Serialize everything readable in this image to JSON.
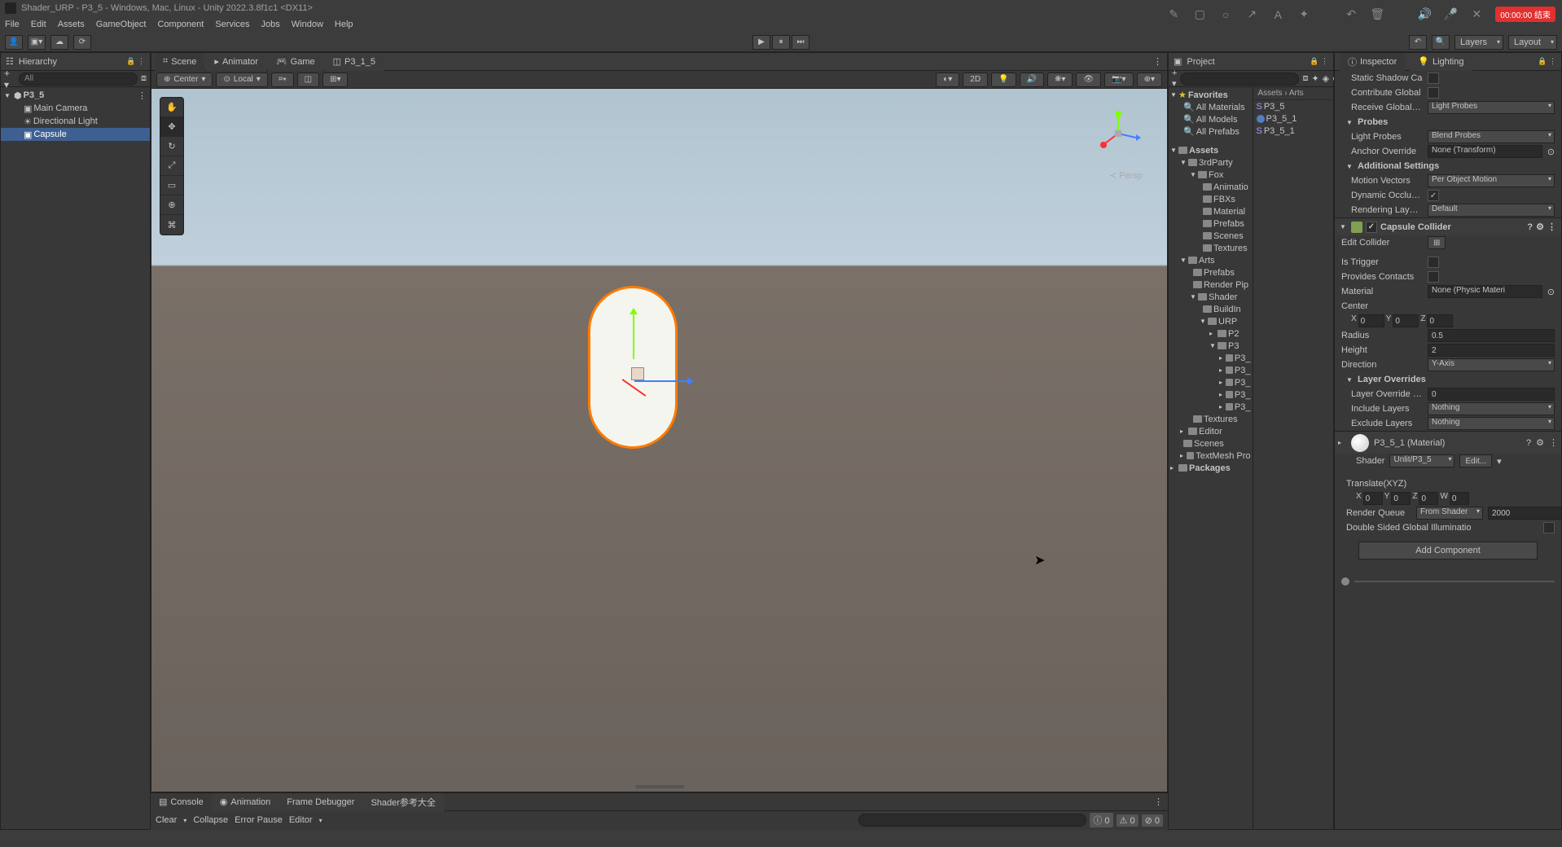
{
  "title": "Shader_URP - P3_5 - Windows, Mac, Linux - Unity 2022.3.8f1c1 <DX11>",
  "menu": {
    "file": "File",
    "edit": "Edit",
    "assets": "Assets",
    "gameObject": "GameObject",
    "component": "Component",
    "services": "Services",
    "jobs": "Jobs",
    "window": "Window",
    "help": "Help"
  },
  "topright": {
    "rec": "00:00:00 结束"
  },
  "toolbar": {
    "layers": "Layers",
    "layout": "Layout"
  },
  "hierarchy": {
    "title": "Hierarchy",
    "search": "All",
    "root": "P3_5",
    "items": [
      "Main Camera",
      "Directional Light",
      "Capsule"
    ]
  },
  "sceneTabs": {
    "scene": "Scene",
    "animator": "Animator",
    "game": "Game",
    "p315": "P3_1_5"
  },
  "sceneBar": {
    "center": "Center",
    "local": "Local",
    "twod": "2D",
    "persp": "Persp"
  },
  "project": {
    "title": "Project",
    "breadcrumb_assets": "Assets",
    "breadcrumb_arts": "Arts",
    "favorites": "Favorites",
    "favItems": [
      "All Materials",
      "All Models",
      "All Prefabs"
    ],
    "assets": "Assets",
    "folders": {
      "thirdparty": "3rdParty",
      "fox": "Fox",
      "animatio": "Animatio",
      "fbxs": "FBXs",
      "material": "Material",
      "prefabs": "Prefabs",
      "scenes": "Scenes",
      "textures": "Textures",
      "arts": "Arts",
      "renderpip": "Render Pip",
      "shader": "Shader",
      "buildin": "BuildIn",
      "urp": "URP",
      "p2": "P2",
      "p3": "P3",
      "p3_": "P3_",
      "editor": "Editor",
      "tmpro": "TextMesh Pro",
      "packages": "Packages"
    },
    "rightItems": [
      "P3_5",
      "P3_5_1",
      "P3_5_1"
    ]
  },
  "inspector": {
    "tab1": "Inspector",
    "tab2": "Lighting",
    "staticShadow": "Static Shadow Ca",
    "contribGlobal": "Contribute Global",
    "recvGlobal": "Receive Global Illu",
    "recvGlobalVal": "Light Probes",
    "probesHdr": "Probes",
    "lightProbes": "Light Probes",
    "lightProbesVal": "Blend Probes",
    "anchorOverride": "Anchor Override",
    "anchorVal": "None (Transform)",
    "addlSettings": "Additional Settings",
    "motionVectors": "Motion Vectors",
    "motionVal": "Per Object Motion",
    "dynOcclusion": "Dynamic Occlusio",
    "renderLayer": "Rendering Layer M",
    "renderLayerVal": "Default",
    "capsuleCollider": "Capsule Collider",
    "editCollider": "Edit Collider",
    "isTrigger": "Is Trigger",
    "providesContacts": "Provides Contacts",
    "material": "Material",
    "materialVal": "None (Physic Materi",
    "center": "Center",
    "cx": "0",
    "cy": "0",
    "cz": "0",
    "radius": "Radius",
    "radiusVal": "0.5",
    "height": "Height",
    "heightVal": "2",
    "direction": "Direction",
    "directionVal": "Y-Axis",
    "layerOverrides": "Layer Overrides",
    "layerOverridePri": "Layer Override Pri",
    "layerOverridePriVal": "0",
    "includeLayers": "Include Layers",
    "includeLayersVal": "Nothing",
    "excludeLayers": "Exclude Layers",
    "excludeLayersVal": "Nothing",
    "matName": "P3_5_1 (Material)",
    "shaderLbl": "Shader",
    "shaderVal": "Unlit/P3_5",
    "editBtn": "Edit...",
    "translateXYZ": "Translate(XYZ)",
    "tx": "0",
    "ty": "0",
    "tz": "0",
    "tw": "0",
    "renderQueue": "Render Queue",
    "renderQueueVal": "From Shader",
    "renderQueueNum": "2000",
    "doubleSided": "Double Sided Global Illuminatio",
    "addComponent": "Add Component"
  },
  "console": {
    "tab1": "Console",
    "tab2": "Animation",
    "tab3": "Frame Debugger",
    "tab4": "Shader参考大全",
    "clear": "Clear",
    "collapse": "Collapse",
    "errorPause": "Error Pause",
    "editor": "Editor",
    "c1": "0",
    "c2": "0",
    "c3": "0"
  }
}
